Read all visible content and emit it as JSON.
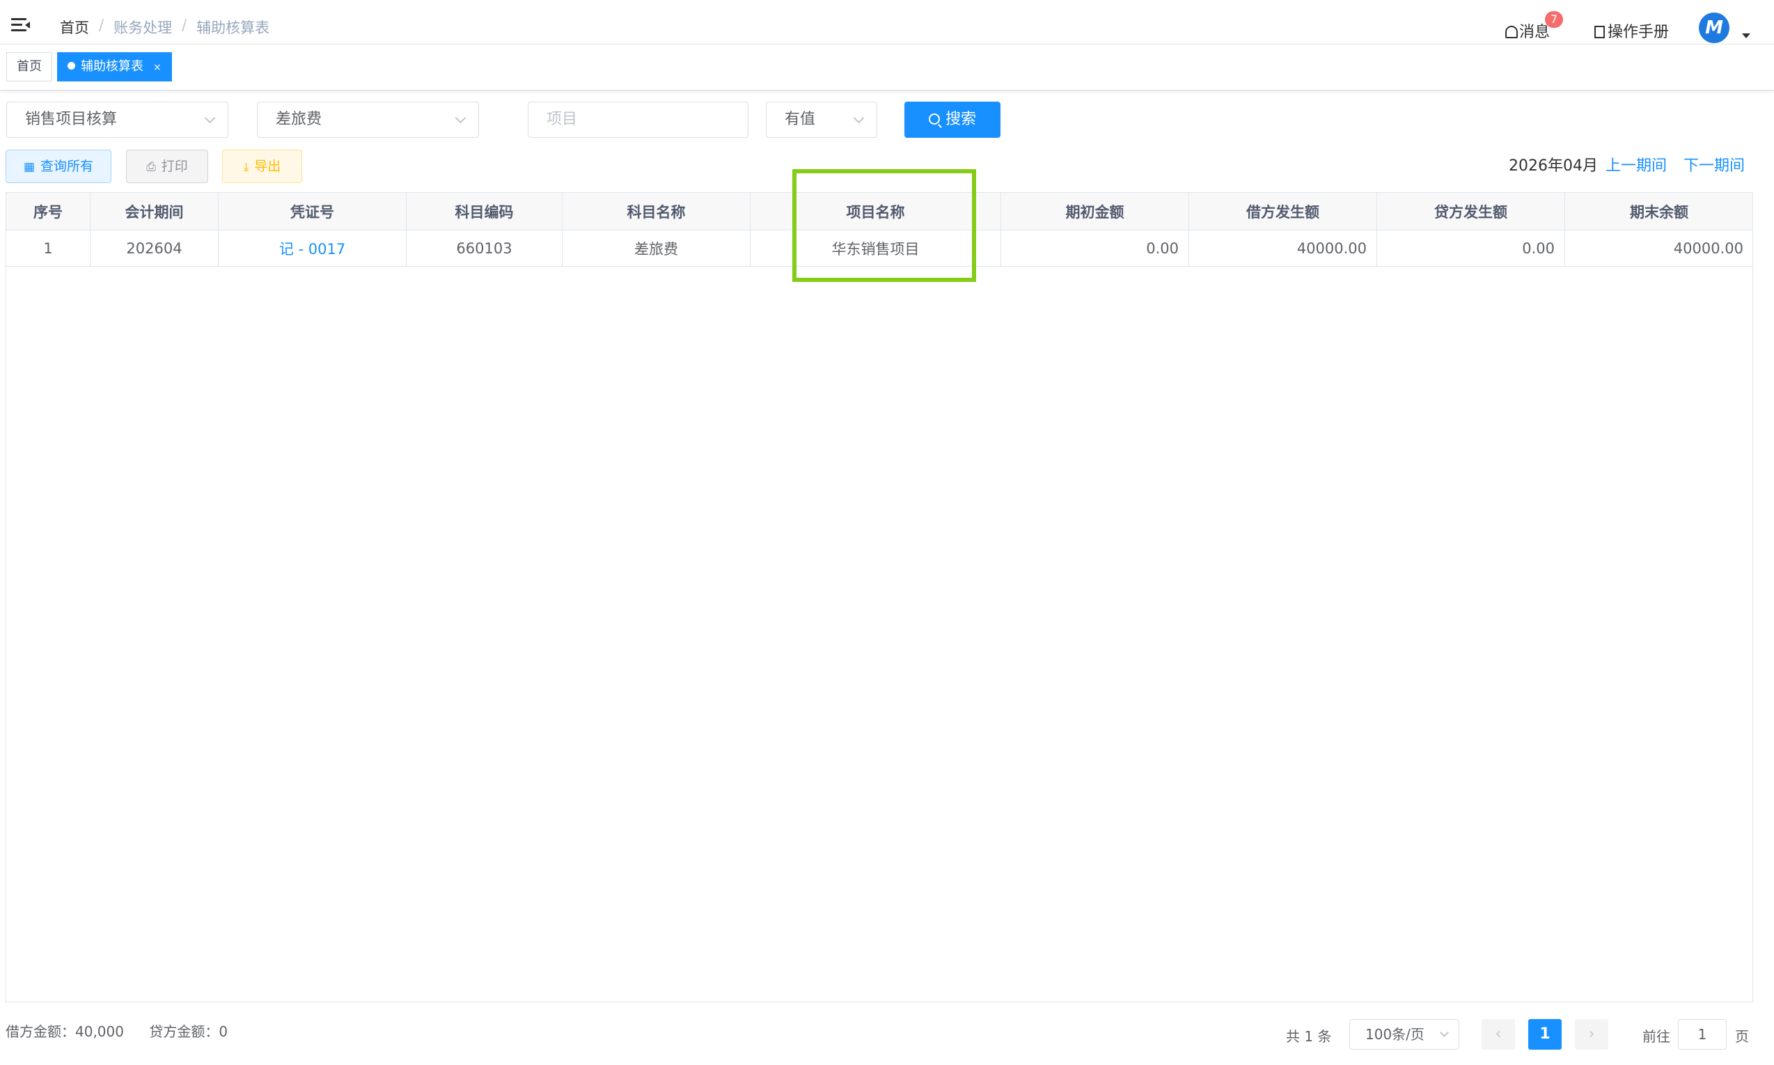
{
  "header": {
    "breadcrumb": [
      "首页",
      "账务处理",
      "辅助核算表"
    ],
    "breadcrumb_sep": "/",
    "messages_label": "消息",
    "messages_badge": "7",
    "manual_label": "操作手册",
    "avatar_letter": "M"
  },
  "tags": [
    {
      "label": "首页",
      "active": false
    },
    {
      "label": "辅助核算表",
      "active": true,
      "close": "×"
    }
  ],
  "filters": {
    "category": "销售项目核算",
    "subject": "差旅费",
    "project_placeholder": "项目",
    "value_filter": "有值",
    "search_label": "搜索"
  },
  "actions": {
    "query_all": "查询所有",
    "print": "打印",
    "export": "导出"
  },
  "period": {
    "current": "2026年04月",
    "prev": "上一期间",
    "next": "下一期间"
  },
  "table": {
    "columns": [
      "序号",
      "会计期间",
      "凭证号",
      "科目编码",
      "科目名称",
      "项目名称",
      "期初金额",
      "借方发生额",
      "贷方发生额",
      "期末余额"
    ],
    "rows": [
      [
        "1",
        "202604",
        "记 - 0017",
        "660103",
        "差旅费",
        "华东销售项目",
        "0.00",
        "40000.00",
        "0.00",
        "40000.00"
      ]
    ]
  },
  "footer": {
    "debit_total": "借方金额：40,000",
    "credit_total": "贷方金额：0",
    "total_count": "共 1 条",
    "page_size": "100条/页",
    "prev_icon": "‹",
    "current_page": "1",
    "next_icon": "›",
    "goto_label": "前往",
    "goto_value": "1",
    "goto_suffix": "页"
  },
  "colors": {
    "primary": "#1890ff",
    "highlight": "#84cc16",
    "badge": "#f56c6c"
  }
}
